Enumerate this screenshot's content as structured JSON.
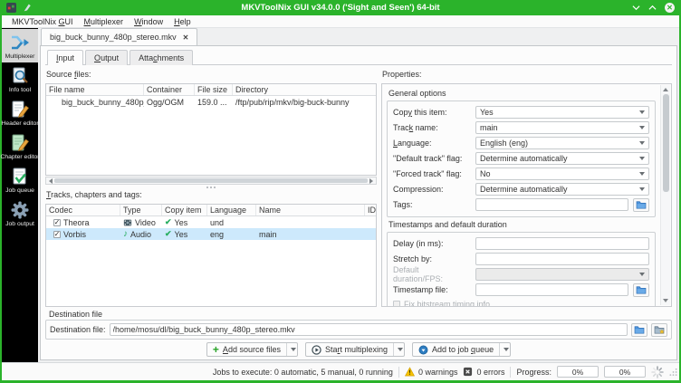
{
  "colors": {
    "accent_green": "#2bb32b",
    "selection_blue": "#cde9fc",
    "check_green": "#27ae60",
    "icon_blue": "#2e7dbe",
    "warning_yellow": "#f7c200"
  },
  "titlebar": {
    "title": "MKVToolNix GUI v34.0.0 ('Sight and Seen') 64-bit"
  },
  "menubar": {
    "items": [
      {
        "text": "MKVToolNix GUI",
        "m": 11
      },
      {
        "text": "Multiplexer",
        "m": 0
      },
      {
        "text": "Window",
        "m": 0
      },
      {
        "text": "Help",
        "m": 0
      }
    ]
  },
  "sidebar": {
    "items": [
      {
        "label": "Multiplexer"
      },
      {
        "label": "Info tool"
      },
      {
        "label": "Header editor"
      },
      {
        "label": "Chapter editor"
      },
      {
        "label": "Job queue"
      },
      {
        "label": "Job output"
      }
    ]
  },
  "document_tab": {
    "label": "big_buck_bunny_480p_stereo.mkv"
  },
  "tabs": [
    {
      "text": "Input",
      "m": 0
    },
    {
      "text": "Output",
      "m": 0
    },
    {
      "text": "Attachments",
      "m": 4
    }
  ],
  "source_files": {
    "label": {
      "text": "Source files:",
      "m": 7
    },
    "columns": [
      "File name",
      "Container",
      "File size",
      "Directory"
    ],
    "rows": [
      {
        "name": "big_buck_bunny_480p_...",
        "container": "Ogg/OGM",
        "size": "159.0 ...",
        "directory": "/ftp/pub/rip/mkv/big-buck-bunny"
      }
    ]
  },
  "tracks": {
    "label": {
      "text": "Tracks, chapters and tags:",
      "m": 0
    },
    "columns": [
      "Codec",
      "Type",
      "Copy item",
      "Language",
      "Name",
      "ID"
    ],
    "rows": [
      {
        "codec": "Theora",
        "type": "Video",
        "copy": "Yes",
        "language": "und",
        "name": ""
      },
      {
        "codec": "Vorbis",
        "type": "Audio",
        "copy": "Yes",
        "language": "eng",
        "name": "main"
      }
    ]
  },
  "properties": {
    "label": "Properties:",
    "general": {
      "title": "General options",
      "fields": [
        {
          "label": {
            "text": "Copy this item:",
            "m": 3
          },
          "value": "Yes"
        },
        {
          "label": {
            "text": "Track name:",
            "m": 4
          },
          "value": "main"
        },
        {
          "label": {
            "text": "Language:",
            "m": 0
          },
          "value": "English (eng)"
        },
        {
          "label": {
            "text": "\"Default track\" flag:",
            "m": -1
          },
          "value": "Determine automatically"
        },
        {
          "label": {
            "text": "\"Forced track\" flag:",
            "m": -1
          },
          "value": "No"
        },
        {
          "label": {
            "text": "Compression:",
            "m": -1
          },
          "value": "Determine automatically"
        },
        {
          "label": {
            "text": "Tags:",
            "m": -1
          },
          "value": ""
        }
      ]
    },
    "timestamps": {
      "title": "Timestamps and default duration",
      "fields": [
        {
          "label": {
            "text": "Delay (in ms):",
            "m": -1
          },
          "value": ""
        },
        {
          "label": {
            "text": "Stretch by:",
            "m": -1
          },
          "value": ""
        },
        {
          "label": {
            "text": "Default duration/FPS:",
            "m": -1
          },
          "value": ""
        },
        {
          "label": {
            "text": "Timestamp file:",
            "m": -1
          },
          "value": ""
        }
      ],
      "checkbox_label": "Fix bitstream timing info"
    }
  },
  "destination": {
    "group_title": "Destination file",
    "label": "Destination file:",
    "value": "/home/mosu/dl/big_buck_bunny_480p_stereo.mkv"
  },
  "actions": [
    {
      "text": "Add source files",
      "m": 0
    },
    {
      "text": "Start multiplexing",
      "m": 3
    },
    {
      "text": "Add to job queue",
      "m": 11
    }
  ],
  "statusbar": {
    "jobs": "Jobs to execute: 0 automatic, 5 manual, 0 running",
    "warnings": "0 warnings",
    "errors": "0 errors",
    "progress_label": "Progress:",
    "progress_current": "0%",
    "progress_total": "0%"
  },
  "glyphs": {
    "close": "✕",
    "checkbox_check": "✓",
    "check": "✔",
    "note": "♪",
    "plus": "+"
  }
}
